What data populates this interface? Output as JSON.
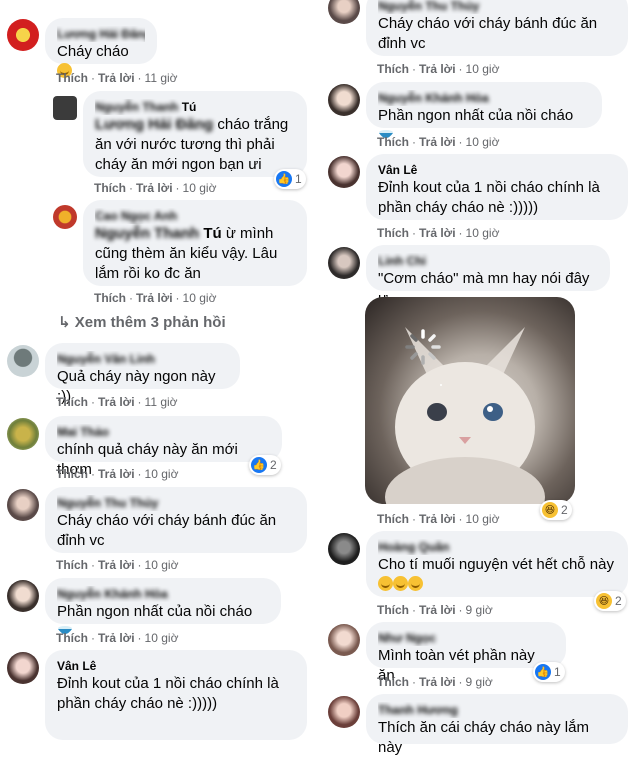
{
  "actions": {
    "like": "Thích",
    "reply": "Trả lời"
  },
  "left": {
    "c1": {
      "name": "Lương Hải Đăng",
      "text": "Cháy cháo",
      "time": "11 giờ"
    },
    "r1": {
      "name": "Nguyễn Thanh Tú",
      "name_visible": "Tú",
      "tag": "Lương Hải Đăng",
      "text": " cháo trắng ăn với nước tương thì phải cháy ăn mới ngon bạn ưi",
      "time": "10 giờ",
      "reacts": "1"
    },
    "r2": {
      "name": "Cao Ngọc Anh",
      "tag": "Nguyễn Thanh",
      "tag_visible": "Tú",
      "text": " ừ mình cũng thèm ăn kiểu vậy. Lâu lắm rồi ko đc ăn",
      "time": "10 giờ"
    },
    "more": "Xem thêm 3 phản hồi",
    "c2": {
      "name": "Nguyễn Văn Linh",
      "text": "Quả cháy này ngon này :))",
      "time": "11 giờ"
    },
    "c3": {
      "name": "Mai Thảo",
      "text": "chính quả cháy này ăn mới thơm",
      "time": "10 giờ",
      "reacts": "2"
    },
    "c4": {
      "name": "Nguyễn Thu Thủy",
      "text": "Cháy cháo với cháy bánh đúc ăn đỉnh vc",
      "time": "10 giờ"
    },
    "c5": {
      "name": "Nguyễn Khánh Hòa",
      "text": "Phần ngon nhất của nồi cháo",
      "time": "10 giờ"
    },
    "c6": {
      "name": "Vân Lê",
      "text": "Đỉnh kout của 1 nồi cháo chính là phần cháy cháo nè :)))))"
    }
  },
  "right": {
    "c1": {
      "name": "Nguyễn Thu Thủy",
      "text": "Cháy cháo với cháy bánh đúc ăn đỉnh vc",
      "time": "10 giờ"
    },
    "c2": {
      "name": "Nguyễn Khánh Hòa",
      "text": "Phần ngon nhất của nồi cháo",
      "time": "10 giờ"
    },
    "c3": {
      "name": "Vân Lê",
      "text": "Đỉnh kout của 1 nồi cháo chính là phần cháy cháo nè :)))))",
      "time": "10 giờ"
    },
    "c4": {
      "name": "Linh Chi",
      "text": "\"Cơm cháo\" mà mn hay nói đây ư",
      "time": "10 giờ",
      "reacts": "2"
    },
    "c5": {
      "name": "Hoàng Quân",
      "text": "Cho tí muối nguyện vét hết chỗ này",
      "time": "9 giờ",
      "reacts": "2"
    },
    "c6": {
      "name": "Như Ngọc",
      "text": "Mình toàn vét phần này ăn",
      "time": "9 giờ",
      "reacts": "1"
    },
    "c7": {
      "name": "Thanh Hương",
      "text": "Thích ăn cái cháy cháo này lắm này"
    }
  },
  "colors": {
    "bubble": "#f0f2f5",
    "meta": "#65676b",
    "like": "#1877f2",
    "haha": "#f7c133"
  }
}
